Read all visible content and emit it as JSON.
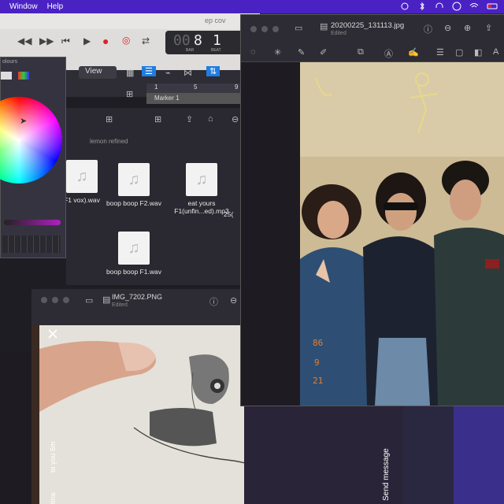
{
  "menubar": {
    "items": [
      "Window",
      "Help"
    ]
  },
  "logic": {
    "title": "ep cov",
    "lcd": {
      "bar_digit1": "00",
      "bar_digit2": "8",
      "beat": "1",
      "bar_label": "BAR",
      "beat_label": "BEAT"
    },
    "view_label": "View",
    "ruler": [
      "1",
      "5",
      "9"
    ],
    "marker": "Marker 1",
    "browser_crumb": "lemon refined",
    "files": [
      {
        "name": "F1 vox).wav"
      },
      {
        "name": "boop boop F2.wav"
      },
      {
        "name": "eat yours F1(unfin...ed).mp3"
      },
      {
        "name": "25("
      },
      {
        "name": "boop boop F1.wav"
      }
    ]
  },
  "colours": {
    "title": "olours"
  },
  "instagram": {
    "title": "IMG_7202.PNG",
    "subtitle": "Edited",
    "send": "Send message",
    "to_you": "to you  6m",
    "user": "tina"
  },
  "preview": {
    "title": "20200225_131113.jpg",
    "subtitle": "Edited",
    "photo_text": [
      "86",
      "9",
      "21"
    ]
  },
  "colors": {
    "menubar": "#4a22c4",
    "record": "#e0202a",
    "accent": "#1f7de0"
  }
}
